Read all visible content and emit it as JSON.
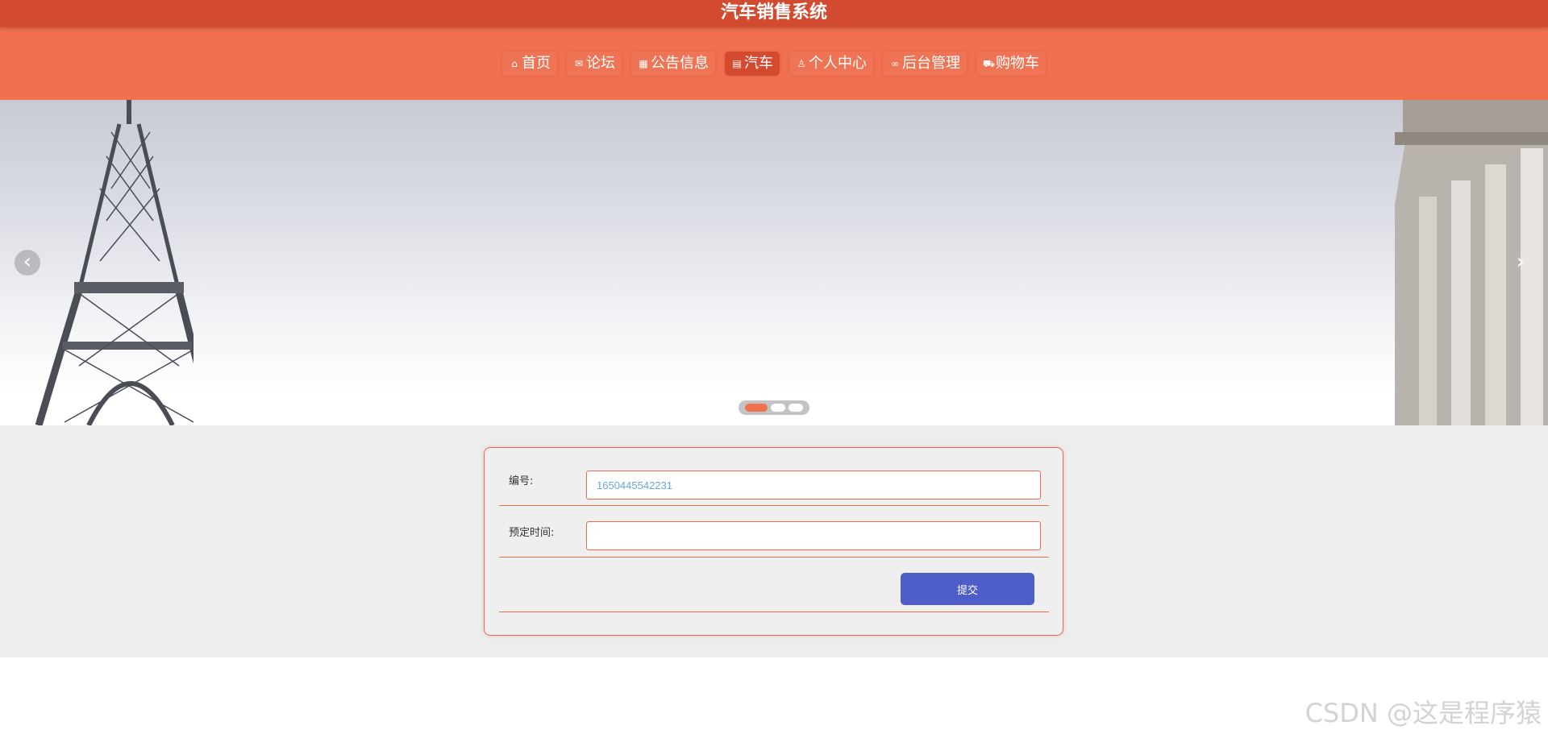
{
  "app": {
    "title": "汽车销售系统"
  },
  "nav": {
    "items": [
      {
        "label": "首页",
        "icon": "home-icon"
      },
      {
        "label": "论坛",
        "icon": "mail-icon"
      },
      {
        "label": "公告信息",
        "icon": "grid-icon"
      },
      {
        "label": "汽车",
        "icon": "document-icon",
        "active": true
      },
      {
        "label": "个人中心",
        "icon": "user-icon"
      },
      {
        "label": "后台管理",
        "icon": "link-icon"
      },
      {
        "label": "购物车",
        "icon": "cart-icon"
      }
    ]
  },
  "banner": {
    "prev_glyph": "‹",
    "next_glyph": "›",
    "slides": 3,
    "active_slide": 1
  },
  "form": {
    "number_label": "编号:",
    "number_value": "1650445542231",
    "time_label": "预定时间:",
    "time_value": "",
    "submit_label": "提交"
  },
  "colors": {
    "title_bar": "#d24b31",
    "nav_bar": "#f07050",
    "active_nav": "#d44a2e",
    "form_border": "#ea6a4e",
    "submit_button": "#4e5dc7"
  },
  "watermark": "CSDN @这是程序猿"
}
